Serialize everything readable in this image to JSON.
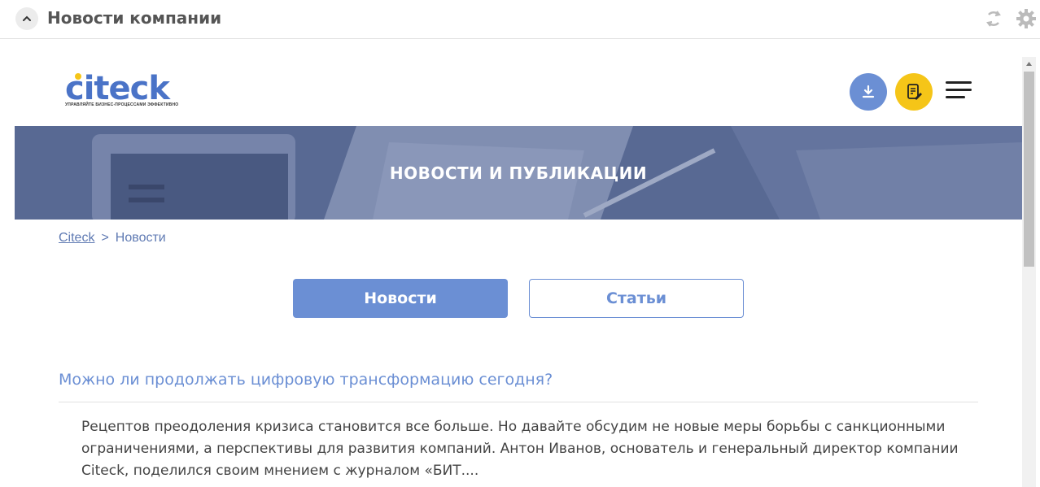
{
  "widget": {
    "title": "Новости компании",
    "icons": {
      "collapse": "chevron-up-icon",
      "refresh": "refresh-icon",
      "settings": "gear-icon"
    }
  },
  "site": {
    "logo_text": "citeck",
    "logo_tagline": "УПРАВЛЯЙТЕ БИЗНЕС-ПРОЦЕССАМИ ЭФФЕКТИВНО",
    "header_icons": {
      "download": "download-icon",
      "note": "note-edit-icon",
      "menu": "hamburger-menu-icon"
    },
    "banner_title": "НОВОСТИ И ПУБЛИКАЦИИ",
    "breadcrumb": {
      "home": "Citeck",
      "separator": ">",
      "current": "Новости"
    },
    "tabs": [
      {
        "label": "Новости",
        "active": true
      },
      {
        "label": "Статьи",
        "active": false
      }
    ],
    "article": {
      "title": "Можно ли продолжать цифровую трансформацию сегодня?",
      "excerpt": "Рецептов преодоления кризиса становится все больше. Но давайте обсудим не новые меры борьбы с санкционными ограничениями, а перспективы для развития компаний. Антон Иванов, основатель и генеральный директор компании Citeck, поделился своим мнением с журналом «БИТ...."
    }
  },
  "colors": {
    "accent": "#6b8fd4",
    "yellow": "#f5c518",
    "banner": "#5c6e96",
    "link": "#5f7ab3"
  }
}
